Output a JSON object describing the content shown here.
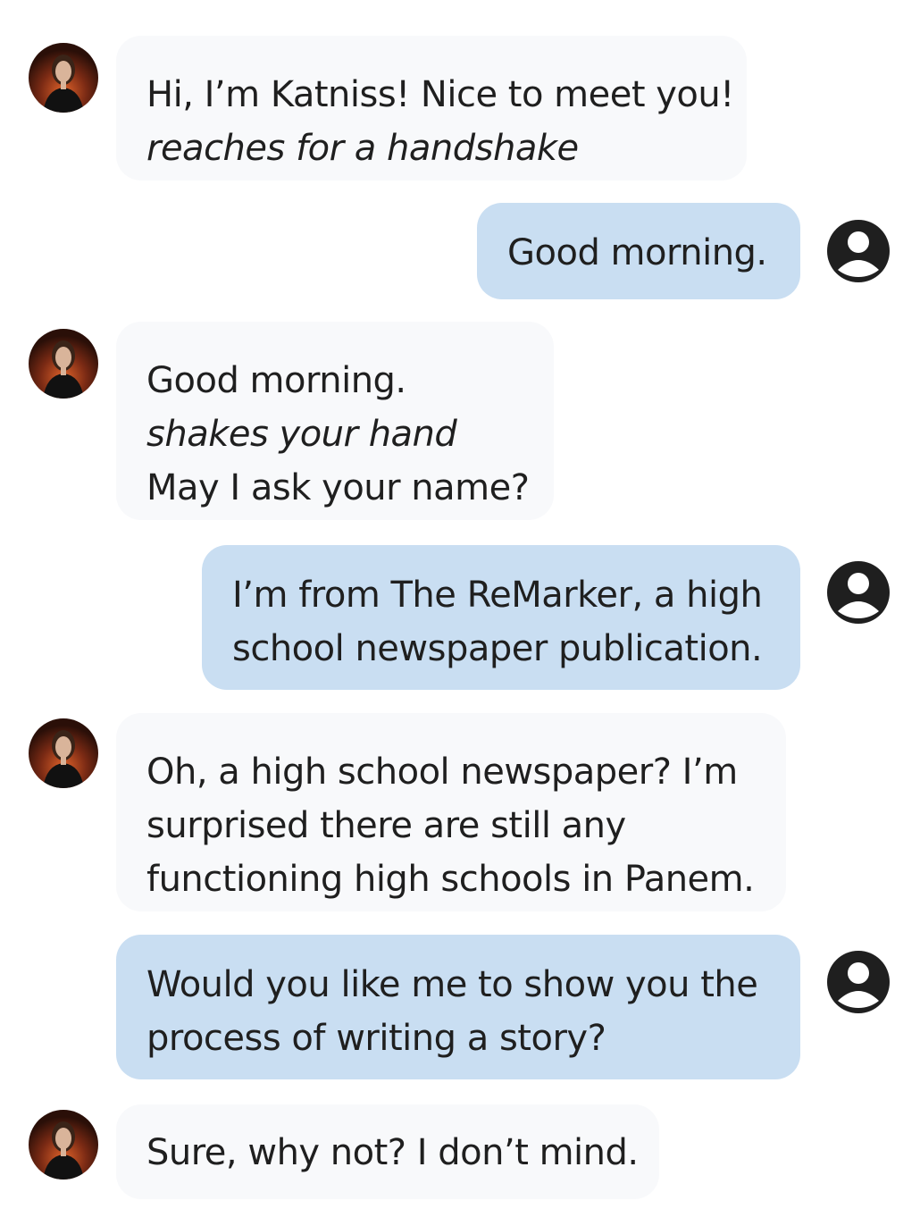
{
  "chat": {
    "messages": [
      {
        "sender": "bot",
        "lines": [
          {
            "text": "Hi, I’m Katniss! Nice to meet you!",
            "italic": false
          },
          {
            "text": "reaches for a handshake",
            "italic": true
          }
        ]
      },
      {
        "sender": "user",
        "lines": [
          {
            "text": "Good morning.",
            "italic": false
          }
        ]
      },
      {
        "sender": "bot",
        "lines": [
          {
            "text": "Good morning.",
            "italic": false
          },
          {
            "text": "shakes your hand",
            "italic": true
          },
          {
            "text": "May I ask your name?",
            "italic": false
          }
        ]
      },
      {
        "sender": "user",
        "lines": [
          {
            "text": "I’m from The ReMarker, a high",
            "italic": false
          },
          {
            "text": "school newspaper publication.",
            "italic": false
          }
        ]
      },
      {
        "sender": "bot",
        "lines": [
          {
            "text": "Oh, a high school newspaper? I’m",
            "italic": false
          },
          {
            "text": "surprised there are still any",
            "italic": false
          },
          {
            "text": "functioning high schools in Panem.",
            "italic": false
          }
        ]
      },
      {
        "sender": "user",
        "lines": [
          {
            "text": "Would you like me to show you the",
            "italic": false
          },
          {
            "text": "process of writing a story?",
            "italic": false
          }
        ]
      },
      {
        "sender": "bot",
        "lines": [
          {
            "text": "Sure, why not? I don’t mind.",
            "italic": false
          }
        ]
      }
    ]
  },
  "icons": {
    "bot_avatar": "character-avatar-icon",
    "user_avatar": "user-account-icon"
  },
  "colors": {
    "bot_bubble": "#f8f9fb",
    "user_bubble": "#c9def2",
    "user_icon": "#1f1f1f"
  }
}
